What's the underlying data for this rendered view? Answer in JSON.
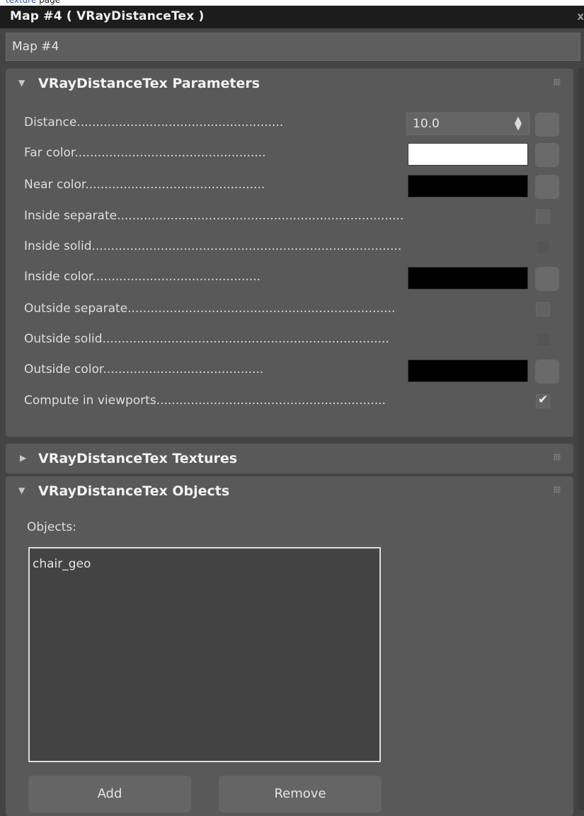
{
  "top_link": {
    "link_text": "texture",
    "rest": " page"
  },
  "window": {
    "title": "Map #4  ( VRayDistanceTex )",
    "close_label": "x"
  },
  "map_name": "Map #4",
  "colors": {
    "far": "#ffffff",
    "near": "#000000",
    "inside": "#000000",
    "outside": "#000000"
  },
  "params": {
    "header": "VRayDistanceTex Parameters",
    "distance_label": "Distance......................................................",
    "distance_value": "10.0",
    "far_color_label": "Far color..................................................",
    "near_color_label": "Near color...............................................",
    "inside_separate_label": "Inside separate...........................................................................",
    "inside_solid_label": "Inside solid.................................................................................",
    "inside_color_label": "Inside color............................................",
    "outside_separate_label": "Outside separate......................................................................",
    "outside_solid_label": "Outside solid...........................................................................",
    "outside_color_label": "Outside color..........................................",
    "compute_label": "Compute in viewports............................................................",
    "compute_checked": "✔"
  },
  "textures": {
    "header": "VRayDistanceTex Textures"
  },
  "objects": {
    "header": "VRayDistanceTex Objects",
    "label": "Objects:",
    "items": [
      "chair_geo"
    ],
    "add_label": "Add",
    "remove_label": "Remove"
  }
}
